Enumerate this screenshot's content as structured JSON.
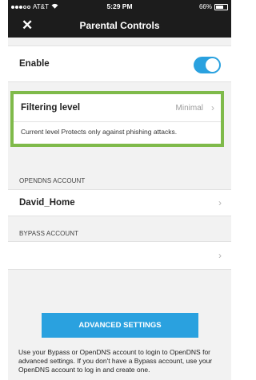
{
  "colors": {
    "accent": "#2aa1df",
    "highlight": "#7fba4a",
    "nav_bg": "#1c1c1c"
  },
  "status_bar": {
    "carrier": "AT&T",
    "time": "5:29 PM",
    "battery": "66%",
    "battery_level": 0.66,
    "signal_bars": 3
  },
  "nav": {
    "title": "Parental Controls",
    "close_icon": "close-icon"
  },
  "enable": {
    "label": "Enable",
    "on": true
  },
  "filtering": {
    "label": "Filtering level",
    "value": "Minimal",
    "description": "Current level Protects only against phishing attacks."
  },
  "opendns": {
    "header": "OPENDNS ACCOUNT",
    "account": "David_Home"
  },
  "bypass": {
    "header": "BYPASS ACCOUNT",
    "account": ""
  },
  "advanced_button": "ADVANCED SETTINGS",
  "footer": "Use your Bypass or OpenDNS account to login to OpenDNS for advanced settings. If you don't have a Bypass account, use your OpenDNS account to log in and create one."
}
